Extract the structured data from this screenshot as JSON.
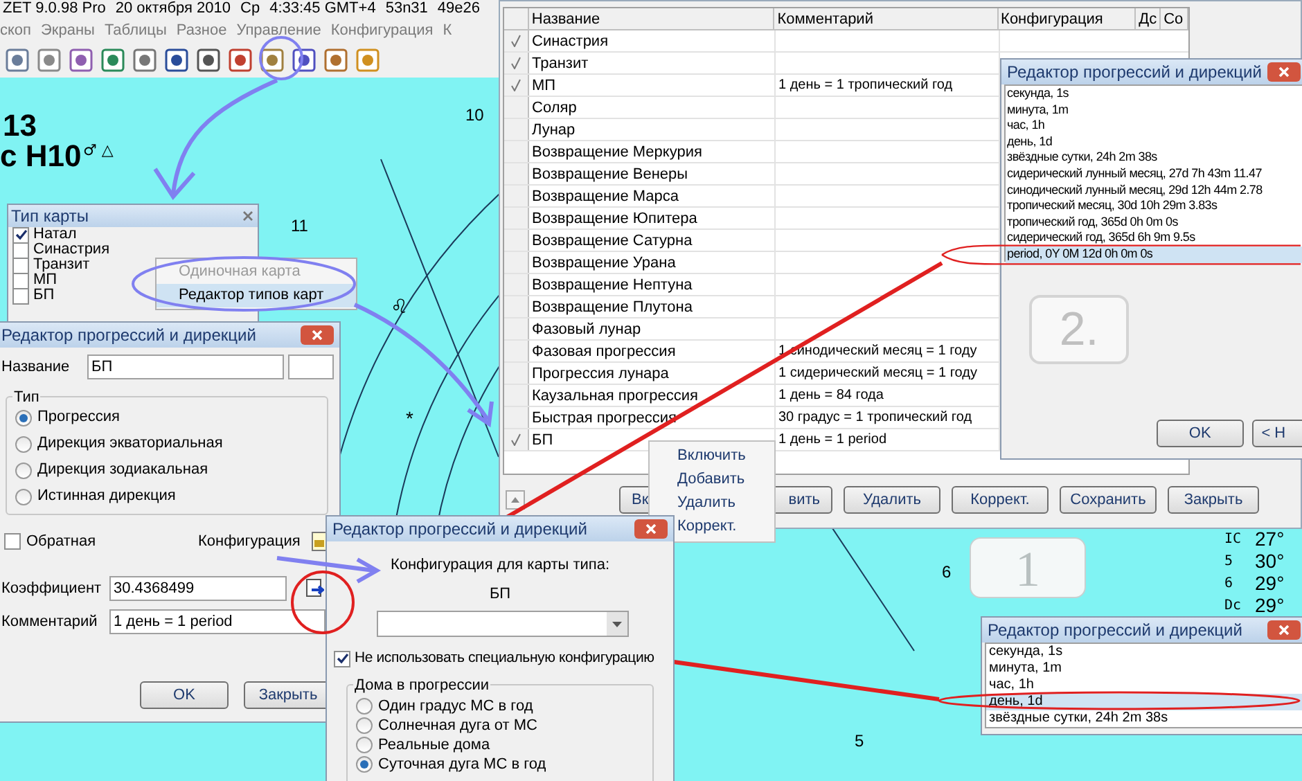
{
  "app_title": [
    "ZET 9.0.98 Pro",
    "20 октября 2010",
    "Ср",
    "4:33:45 GMT+4",
    "53n31",
    "49e26"
  ],
  "menu": [
    "скоп",
    "Экраны",
    "Таблицы",
    "Разное",
    "Управление",
    "Конфигурация",
    "К"
  ],
  "chart_labels": {
    "title_number": "13",
    "subtitle": "с Н10",
    "aspect_glyphs": "♂ △",
    "houses": [
      "10",
      "11",
      "6",
      "5"
    ],
    "sign": "♌",
    "star": "*"
  },
  "side_table": [
    {
      "symbol": "IC",
      "degree": "27°"
    },
    {
      "symbol": "5",
      "degree": "30°"
    },
    {
      "symbol": "6",
      "degree": "29°"
    },
    {
      "symbol": "Dc",
      "degree": "29°"
    }
  ],
  "chart_type_panel": {
    "title": "Тип карты",
    "items": [
      {
        "label": "Натал",
        "checked": true
      },
      {
        "label": "Синастрия",
        "checked": false
      },
      {
        "label": "Транзит",
        "checked": false
      },
      {
        "label": "МП",
        "checked": false
      },
      {
        "label": "БП",
        "checked": false
      }
    ]
  },
  "chart_type_menu": [
    {
      "label": "Одиночная карта",
      "disabled": true,
      "selected": false
    },
    {
      "label": "Редактор типов карт",
      "disabled": false,
      "selected": true
    }
  ],
  "editor_dialog": {
    "title": "Редактор прогрессий и дирекций",
    "name_label": "Название",
    "name_value": "БП",
    "type_group": "Тип",
    "types": [
      {
        "label": "Прогрессия",
        "selected": true
      },
      {
        "label": "Дирекция экваториальная",
        "selected": false
      },
      {
        "label": "Дирекция зодиакальная",
        "selected": false
      },
      {
        "label": "Истинная дирекция",
        "selected": false
      }
    ],
    "reverse": {
      "label": "Обратная",
      "checked": false
    },
    "config_label": "Конфигурация",
    "coef_label": "Коэффициент",
    "coef_value": "30.4368499",
    "comment_label": "Комментарий",
    "comment_value": "1 день = 1 period",
    "buttons": [
      "OK",
      "Закрыть"
    ]
  },
  "chart_types_table": {
    "columns": [
      "Название",
      "Комментарий",
      "Конфигурация",
      "Дс",
      "Со"
    ],
    "rows": [
      {
        "name": "Синастрия",
        "comment": "",
        "checked": true
      },
      {
        "name": "Транзит",
        "comment": "",
        "checked": true
      },
      {
        "name": "МП",
        "comment": "1 день = 1 тропический год",
        "checked": true
      },
      {
        "name": "Соляр",
        "comment": "",
        "checked": false
      },
      {
        "name": "Лунар",
        "comment": "",
        "checked": false
      },
      {
        "name": "Возвращение Меркурия",
        "comment": "",
        "checked": false
      },
      {
        "name": "Возвращение Венеры",
        "comment": "",
        "checked": false
      },
      {
        "name": "Возвращение Марса",
        "comment": "",
        "checked": false
      },
      {
        "name": "Возвращение Юпитера",
        "comment": "",
        "checked": false
      },
      {
        "name": "Возвращение Сатурна",
        "comment": "",
        "checked": false
      },
      {
        "name": "Возвращение Урана",
        "comment": "",
        "checked": false
      },
      {
        "name": "Возвращение Нептуна",
        "comment": "",
        "checked": false
      },
      {
        "name": "Возвращение Плутона",
        "comment": "",
        "checked": false
      },
      {
        "name": "Фазовый лунар",
        "comment": "",
        "checked": false
      },
      {
        "name": "Фазовая прогрессия",
        "comment": "1 синодический месяц = 1 году",
        "checked": false
      },
      {
        "name": "Прогрессия лунара",
        "comment": "1 сидерический месяц = 1 году",
        "checked": false
      },
      {
        "name": "Каузальная прогрессия",
        "comment": "1 день = 84 года",
        "checked": false
      },
      {
        "name": "Быстрая прогрессия",
        "comment": "30 градус = 1 тропический год",
        "checked": false
      },
      {
        "name": "БП",
        "comment": "1 день = 1 period",
        "checked": true
      }
    ],
    "buttons": [
      "Вк",
      "вить",
      "Удалить",
      "Коррект.",
      "Сохранить",
      "Закрыть"
    ]
  },
  "row_menu": [
    "Включить",
    "Добавить",
    "Удалить",
    "Коррект."
  ],
  "period_dialog": {
    "title": "Редактор прогрессий и дирекций",
    "items": [
      {
        "label": "секунда, 1s",
        "selected": false
      },
      {
        "label": "минута, 1m",
        "selected": false
      },
      {
        "label": "час, 1h",
        "selected": false
      },
      {
        "label": "день, 1d",
        "selected": false
      },
      {
        "label": "звёздные сутки, 24h 2m 38s",
        "selected": false
      },
      {
        "label": "сидерический лунный месяц, 27d 7h 43m 11.47",
        "selected": false
      },
      {
        "label": "синодический лунный месяц, 29d 12h 44m 2.78",
        "selected": false
      },
      {
        "label": "тропический месяц, 30d 10h 29m 3.83s",
        "selected": false
      },
      {
        "label": "тропический год, 365d 0h 0m 0s",
        "selected": false
      },
      {
        "label": "сидерический год, 365d 6h 9m 9.5s",
        "selected": false
      },
      {
        "label": "period, 0Y 0M 12d 0h 0m 0s",
        "selected": true
      }
    ],
    "step_badge": "2.",
    "buttons": [
      "OK",
      "< Н"
    ]
  },
  "config_dialog": {
    "title": "Редактор прогрессий и дирекций",
    "caption": "Конфигурация для карты типа:",
    "type_name": "БП",
    "no_config": {
      "label": "Не использовать специальную конфигурацию",
      "checked": true
    },
    "houses_group": "Дома в прогрессии",
    "houses": [
      {
        "label": "Один градус МС в год",
        "selected": false
      },
      {
        "label": "Солнечная дуга от МС",
        "selected": false
      },
      {
        "label": "Реальные дома",
        "selected": false
      },
      {
        "label": "Суточная дуга МС в год",
        "selected": true
      }
    ]
  },
  "step_badge_1": "1",
  "unit_dialog": {
    "title": "Редактор прогрессий и дирекций",
    "items": [
      {
        "label": "секунда, 1s",
        "selected": false
      },
      {
        "label": "минута, 1m",
        "selected": false
      },
      {
        "label": "час, 1h",
        "selected": false
      },
      {
        "label": "день, 1d",
        "selected": true
      },
      {
        "label": "звёздные сутки, 24h 2m 38s",
        "selected": false
      }
    ]
  }
}
